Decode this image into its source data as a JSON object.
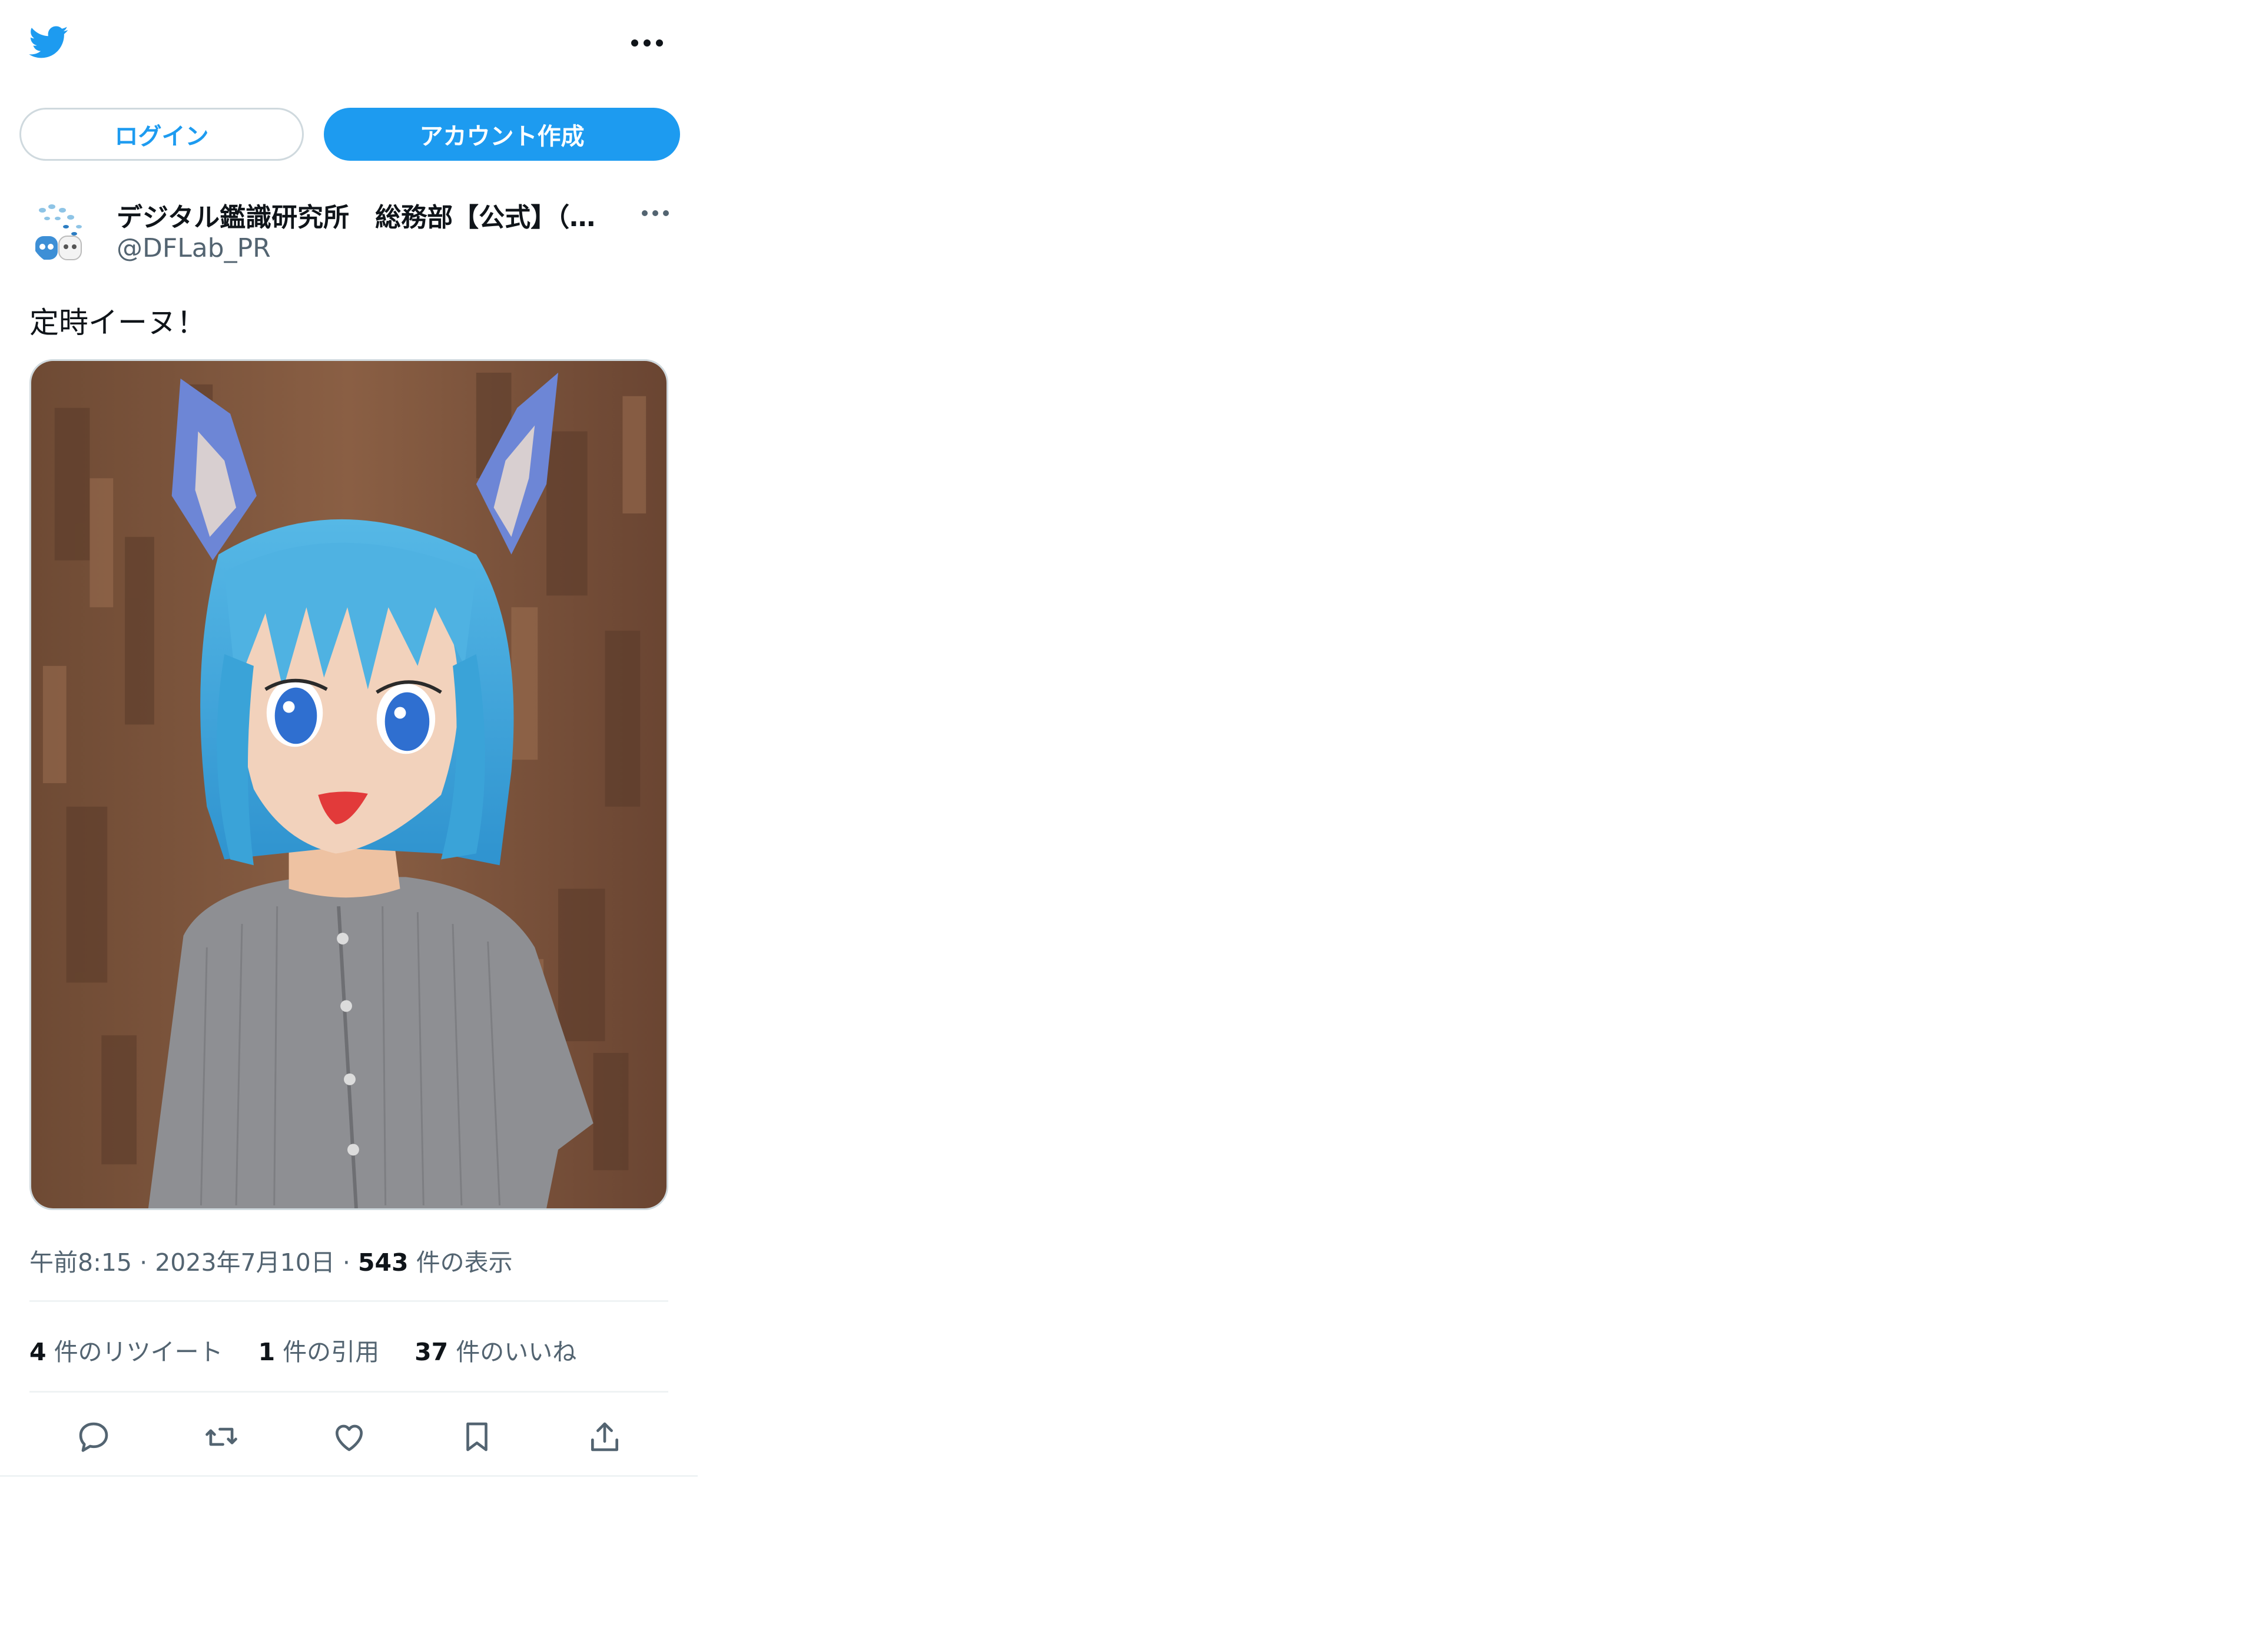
{
  "header": {
    "logo_icon": "twitter-bird-icon",
    "more_icon": "more-horizontal-icon"
  },
  "auth": {
    "login_label": "ログイン",
    "signup_label": "アカウント作成"
  },
  "tweet": {
    "author_name": "デジタル鑑識研究所　総務部【公式】（…",
    "author_handle": "@DFLab_PR",
    "text": "定時イーヌ！",
    "time": "午前8:15",
    "date": "2023年7月10日",
    "views_count": "543",
    "views_label": "件の表示",
    "stats": {
      "retweets_count": "4",
      "retweets_label": "件のリツイート",
      "quotes_count": "1",
      "quotes_label": "件の引用",
      "likes_count": "37",
      "likes_label": "件のいいね"
    },
    "actions": [
      "reply-icon",
      "retweet-icon",
      "like-icon",
      "bookmark-icon",
      "share-icon"
    ]
  },
  "colors": {
    "accent": "#1d9bf0",
    "text": "#0f1419",
    "muted": "#536471",
    "border": "#cfd9de"
  }
}
